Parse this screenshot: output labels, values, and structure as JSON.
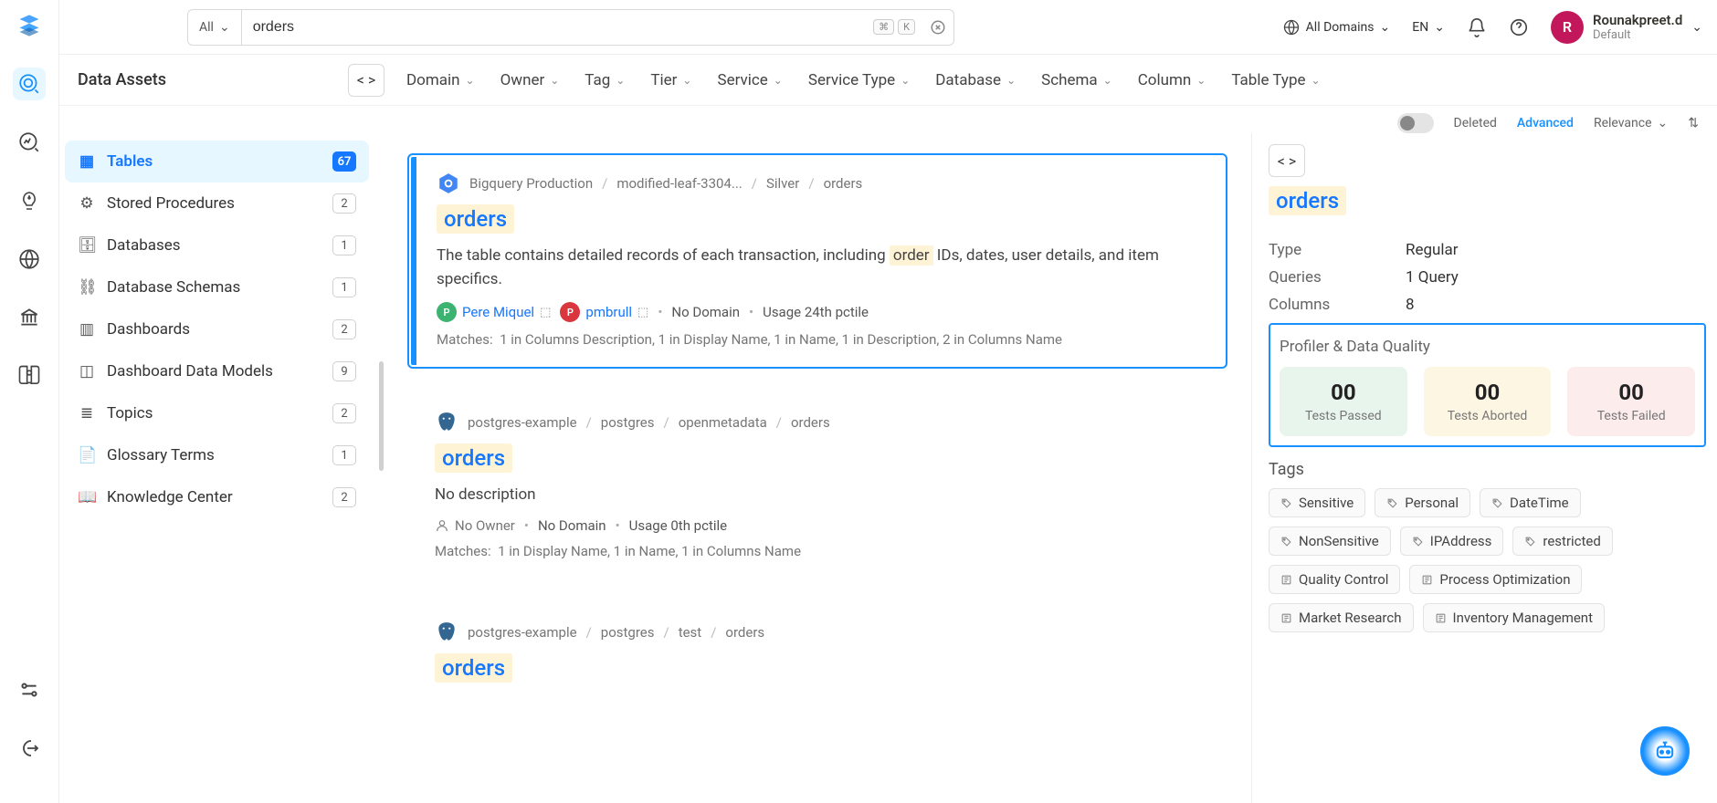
{
  "search": {
    "segment": "All",
    "value": "orders",
    "kbd1": "⌘",
    "kbd2": "K"
  },
  "topbar": {
    "domains": "All Domains",
    "lang": "EN",
    "user_name": "Rounakpreet.d",
    "user_role": "Default",
    "user_initial": "R"
  },
  "data_assets_title": "Data Assets",
  "filters": [
    "Domain",
    "Owner",
    "Tag",
    "Tier",
    "Service",
    "Service Type",
    "Database",
    "Schema",
    "Column",
    "Table Type"
  ],
  "filterbar": {
    "deleted": "Deleted",
    "advanced": "Advanced",
    "relevance": "Relevance"
  },
  "assets": [
    {
      "label": "Tables",
      "count": "67",
      "icon": "▦"
    },
    {
      "label": "Stored Procedures",
      "count": "2",
      "icon": "⚙"
    },
    {
      "label": "Databases",
      "count": "1",
      "icon": "🗄"
    },
    {
      "label": "Database Schemas",
      "count": "1",
      "icon": "⛓"
    },
    {
      "label": "Dashboards",
      "count": "2",
      "icon": "▥"
    },
    {
      "label": "Dashboard Data Models",
      "count": "9",
      "icon": "◫"
    },
    {
      "label": "Topics",
      "count": "2",
      "icon": "≣"
    },
    {
      "label": "Glossary Terms",
      "count": "1",
      "icon": "📄"
    },
    {
      "label": "Knowledge Center",
      "count": "2",
      "icon": "📖"
    }
  ],
  "results": [
    {
      "crumbs": [
        "Bigquery Production",
        "modified-leaf-3304...",
        "Silver",
        "orders"
      ],
      "title": "orders",
      "desc_pre": "The table contains detailed records of each transaction, including ",
      "desc_hl": "order",
      "desc_post": " IDs, dates, user details, and item specifics.",
      "owner1": "Pere Miquel",
      "owner2": "pmbrull",
      "domain": "No Domain",
      "usage": "Usage 24th pctile",
      "matches_label": "Matches:",
      "matches": "1 in Columns Description,   1 in Display Name,   1 in Name,   1 in Description,   2 in Columns Name"
    },
    {
      "crumbs": [
        "postgres-example",
        "postgres",
        "openmetadata",
        "orders"
      ],
      "title": "orders",
      "desc_plain": "No description",
      "no_owner": "No Owner",
      "domain": "No Domain",
      "usage": "Usage 0th pctile",
      "matches_label": "Matches:",
      "matches": "1 in Display Name,   1 in Name,   1 in Columns Name"
    },
    {
      "crumbs": [
        "postgres-example",
        "postgres",
        "test",
        "orders"
      ],
      "title": "orders"
    }
  ],
  "detail": {
    "title": "orders",
    "rows": [
      {
        "label": "Type",
        "value": "Regular"
      },
      {
        "label": "Queries",
        "value": "1 Query"
      },
      {
        "label": "Columns",
        "value": "8"
      }
    ],
    "profiler_title": "Profiler & Data Quality",
    "metrics": [
      {
        "num": "00",
        "label": "Tests Passed"
      },
      {
        "num": "00",
        "label": "Tests Aborted"
      },
      {
        "num": "00",
        "label": "Tests Failed"
      }
    ],
    "tags_title": "Tags",
    "tags_classif": [
      "Sensitive",
      "Personal",
      "DateTime",
      "NonSensitive",
      "IPAddress",
      "restricted"
    ],
    "tags_gloss": [
      "Quality Control",
      "Process Optimization",
      "Market Research",
      "Inventory Management"
    ]
  }
}
